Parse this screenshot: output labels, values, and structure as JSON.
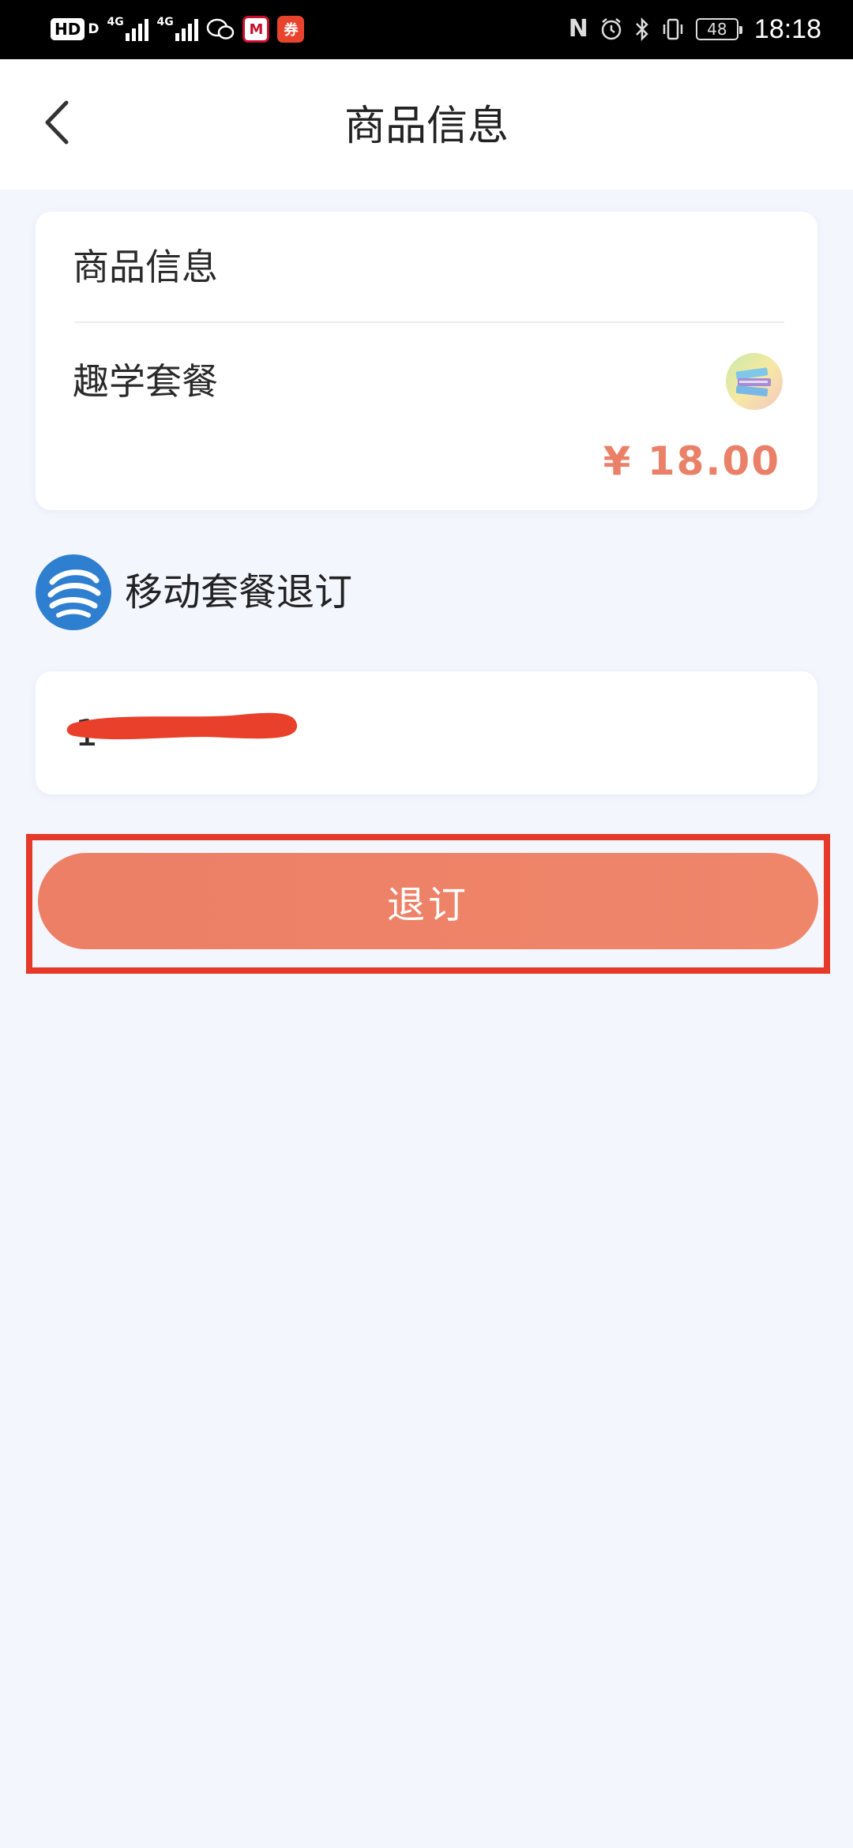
{
  "status_bar": {
    "hd_label": "HD",
    "hd_sub": "D",
    "network_1": "4G",
    "network_2": "4G",
    "bank_icon_glyph": "M",
    "promo_icon_glyph": "券",
    "nfc_glyph": "N",
    "battery": "48",
    "time": "18:18"
  },
  "nav": {
    "title": "商品信息"
  },
  "product": {
    "section_title": "商品信息",
    "name": "趣学套餐",
    "price": "¥ 18.00"
  },
  "carrier": {
    "label": "移动套餐退订"
  },
  "phone": {
    "number": "1"
  },
  "actions": {
    "unsubscribe_label": "退订"
  },
  "colors": {
    "accent": "#ec7f66",
    "price": "#ea8068",
    "highlight": "#e53a2a",
    "background": "#f3f6fd",
    "carrier_blue": "#2f7fd1"
  }
}
